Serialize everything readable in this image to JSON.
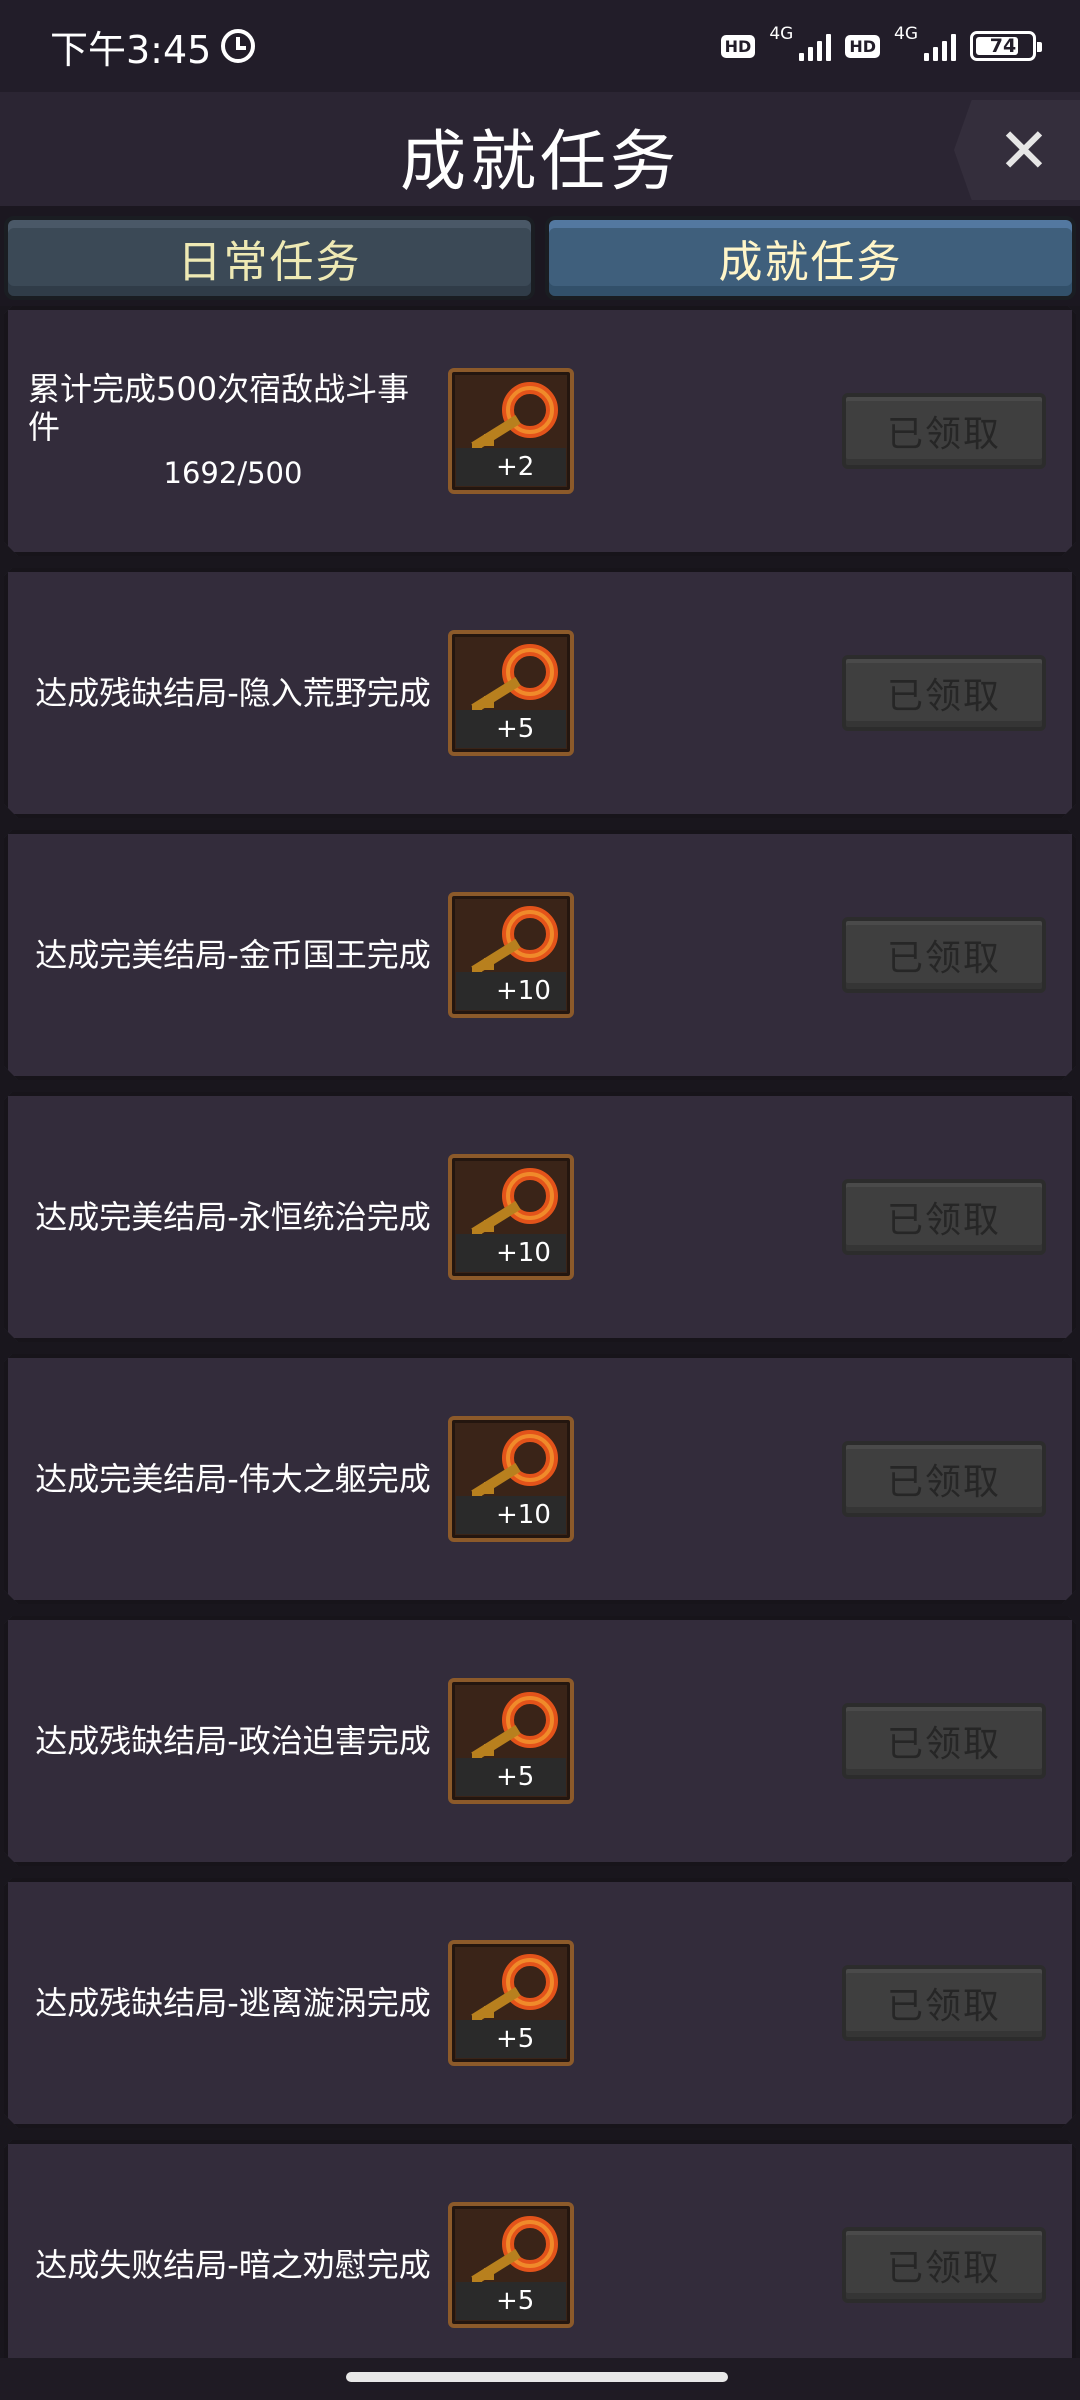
{
  "status_bar": {
    "time": "下午3:45",
    "hd1": "HD",
    "net1": "4G",
    "hd2": "HD",
    "net2": "4G",
    "battery": "74"
  },
  "header": {
    "title": "成就任务",
    "close": "✕"
  },
  "tabs": [
    {
      "label": "日常任务",
      "active": false
    },
    {
      "label": "成就任务",
      "active": true
    }
  ],
  "achievements": [
    {
      "title": "累计完成500次宿敌战斗事件",
      "progress": "1692/500",
      "reward": "+2",
      "button": "已领取"
    },
    {
      "title": "达成残缺结局-隐入荒野完成",
      "reward": "+5",
      "button": "已领取"
    },
    {
      "title": "达成完美结局-金币国王完成",
      "reward": "+10",
      "button": "已领取"
    },
    {
      "title": "达成完美结局-永恒统治完成",
      "reward": "+10",
      "button": "已领取"
    },
    {
      "title": "达成完美结局-伟大之躯完成",
      "reward": "+10",
      "button": "已领取"
    },
    {
      "title": "达成残缺结局-政治迫害完成",
      "reward": "+5",
      "button": "已领取"
    },
    {
      "title": "达成残缺结局-逃离漩涡完成",
      "reward": "+5",
      "button": "已领取"
    },
    {
      "title": "达成失败结局-暗之劝慰完成",
      "reward": "+5",
      "button": "已领取"
    }
  ],
  "icons": {
    "reward": "key-icon",
    "close": "close-icon",
    "alarm": "alarm-icon"
  }
}
